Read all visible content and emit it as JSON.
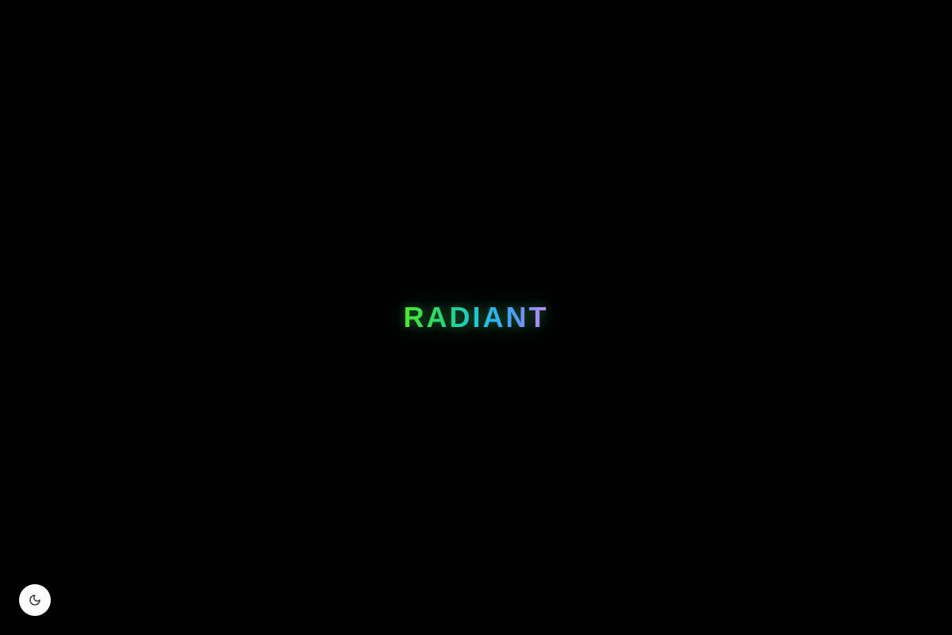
{
  "logo": {
    "text": "RADIANT"
  },
  "theme_toggle": {
    "icon": "moon-icon"
  },
  "colors": {
    "background": "#000000",
    "gradient": [
      "#4dea2c",
      "#22d480",
      "#1cc8d8",
      "#3aa6ff",
      "#7f8cff",
      "#c88bf2"
    ],
    "toggle_background": "#ffffff",
    "toggle_icon": "#222222"
  }
}
